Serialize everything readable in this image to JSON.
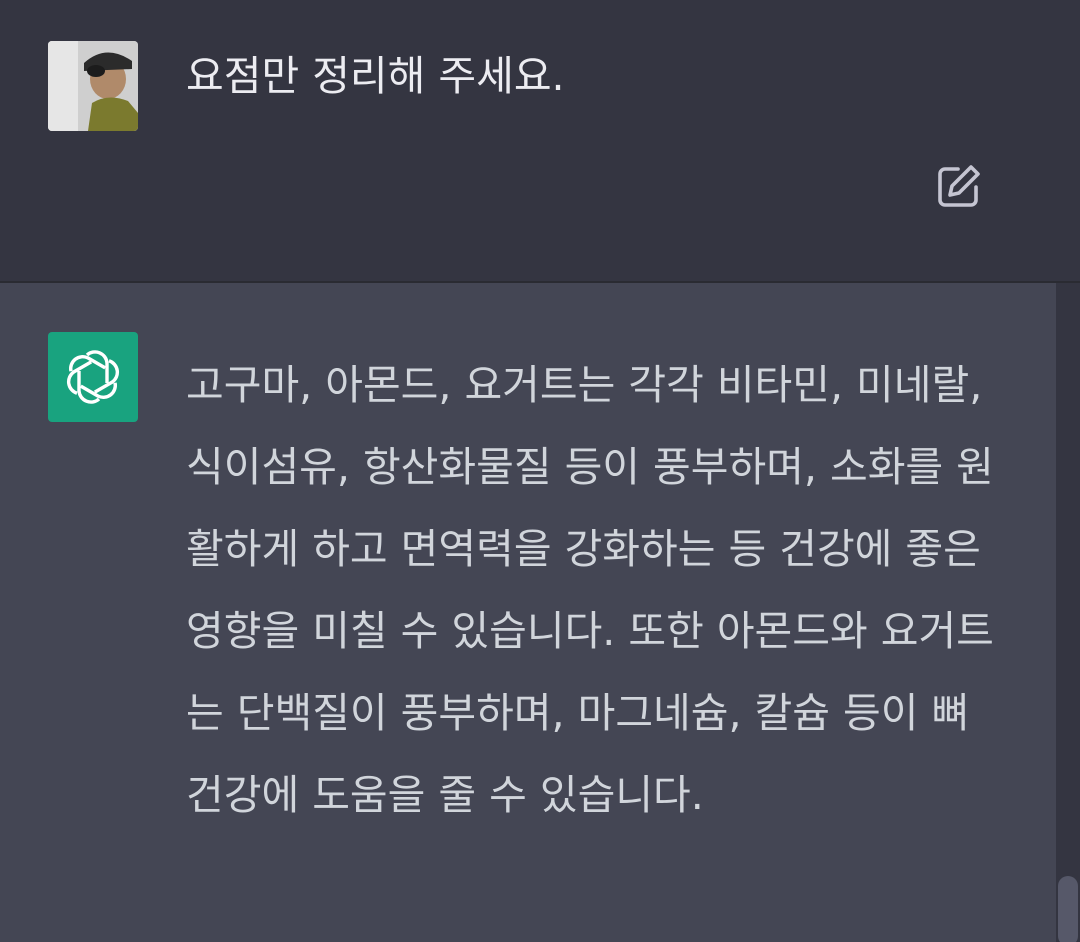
{
  "user_message": {
    "text": "요점만 정리해 주세요.",
    "avatar": "user-photo-avatar",
    "edit_icon": "edit-icon"
  },
  "assistant_message": {
    "logo": "openai-logo-icon",
    "text": "고구마, 아몬드, 요거트는 각각 비타민, 미네랄, 식이섬유, 항산화물질 등이 풍부하며, 소화를 원활하게 하고 면역력을 강화하는 등 건강에 좋은 영향을 미칠 수 있습니다. 또한 아몬드와 요거트는 단백질이 풍부하며, 마그네슘, 칼슘 등이 뼈 건강에 도움을 줄 수 있습니다."
  },
  "colors": {
    "user_bg": "#343541",
    "assistant_bg": "#444654",
    "logo_bg": "#19a37f",
    "text": "#ececf1"
  }
}
